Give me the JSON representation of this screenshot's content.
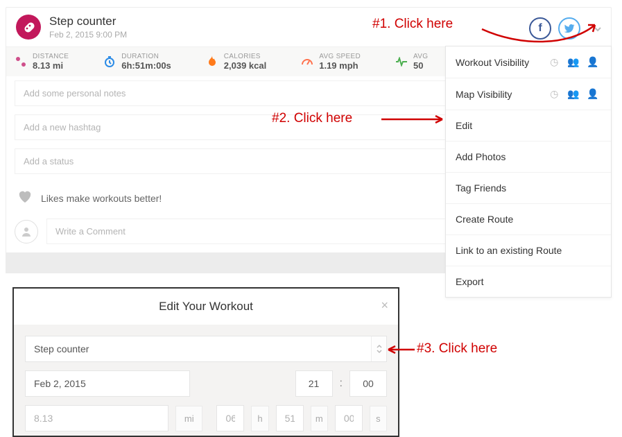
{
  "header": {
    "title": "Step counter",
    "subtitle": "Feb 2, 2015 9:00 PM"
  },
  "stats": {
    "distance": {
      "label": "DISTANCE",
      "value": "8.13 mi"
    },
    "duration": {
      "label": "DURATION",
      "value": "6h:51m:00s"
    },
    "calories": {
      "label": "CALORIES",
      "value": "2,039 kcal"
    },
    "avgspeed": {
      "label": "AVG SPEED",
      "value": "1.19 mph"
    },
    "avghr": {
      "label": "AVG",
      "value": "50"
    }
  },
  "fields": {
    "notes_placeholder": "Add some personal notes",
    "hashtag_placeholder": "Add a new hashtag",
    "status_placeholder": "Add a status",
    "likes_text": "Likes make workouts better!",
    "comment_placeholder": "Write a Comment"
  },
  "menu": {
    "items": [
      "Workout Visibility",
      "Map Visibility",
      "Edit",
      "Add Photos",
      "Tag Friends",
      "Create Route",
      "Link to an existing Route",
      "Export"
    ]
  },
  "modal": {
    "title": "Edit Your Workout",
    "activity": "Step counter",
    "date": "Feb 2, 2015",
    "hour": "21",
    "minute": "00",
    "distance": "8.13",
    "dist_unit": "mi",
    "dur_h": "06",
    "unit_h": "h",
    "dur_m": "51",
    "unit_m": "m",
    "dur_s": "00",
    "unit_s": "s"
  },
  "annotations": {
    "a1": "#1.  Click here",
    "a2": "#2.  Click here",
    "a3": "#3. Click here"
  },
  "social": {
    "fb": "f",
    "tw_label": "twitter"
  }
}
